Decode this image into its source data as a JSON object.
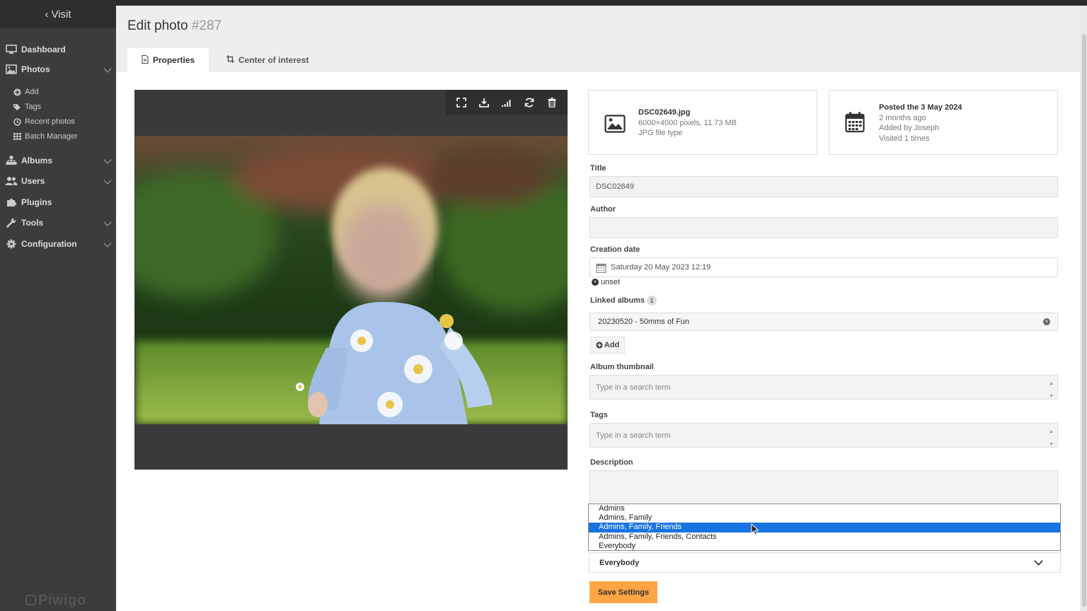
{
  "sidebar": {
    "visit_label": "Visit",
    "menu": [
      {
        "label": "Dashboard",
        "icon": "monitor-icon"
      },
      {
        "label": "Photos",
        "icon": "image-icon",
        "expandable": true
      },
      {
        "label": "Albums",
        "icon": "sitemap-icon",
        "expandable": true
      },
      {
        "label": "Users",
        "icon": "users-icon",
        "expandable": true
      },
      {
        "label": "Plugins",
        "icon": "puzzle-icon"
      },
      {
        "label": "Tools",
        "icon": "wrench-icon",
        "expandable": true
      },
      {
        "label": "Configuration",
        "icon": "gear-icon",
        "expandable": true
      }
    ],
    "photos_submenu": [
      {
        "label": "Add",
        "icon": "plus-circle-icon"
      },
      {
        "label": "Tags",
        "icon": "tags-icon"
      },
      {
        "label": "Recent photos",
        "icon": "clock-icon"
      },
      {
        "label": "Batch Manager",
        "icon": "grid-icon"
      }
    ],
    "brand": "Piwigo"
  },
  "page": {
    "title": "Edit photo",
    "photo_id": "#287"
  },
  "tabs": [
    {
      "label": "Properties",
      "active": true,
      "icon": "file-icon"
    },
    {
      "label": "Center of interest",
      "active": false,
      "icon": "crop-icon"
    }
  ],
  "photo_toolbar": [
    "fullscreen-icon",
    "download-icon",
    "signal-icon",
    "sync-icon",
    "trash-icon"
  ],
  "file_info": {
    "filename": "DSC02649.jpg",
    "dimensions": "6000×4000 pixels, 11.73 MB",
    "filetype": "JPG file type"
  },
  "post_info": {
    "posted": "Posted the 3 May 2024",
    "ago": "2 months ago",
    "added_by": "Added by Joseph",
    "visited": "Visited 1 times"
  },
  "form": {
    "title_label": "Title",
    "title_value": "DSC02649",
    "author_label": "Author",
    "author_value": "",
    "creation_date_label": "Creation date",
    "creation_date_value": "Saturday 20 May 2023 12:19",
    "unset_label": "unset",
    "linked_albums_label": "Linked albums",
    "linked_albums_count": "1",
    "linked_album": "20230520 - 50mms of Fun",
    "add_label": "Add",
    "album_thumbnail_label": "Album thumbnail",
    "album_thumbnail_placeholder": "Type in a search term",
    "tags_label": "Tags",
    "tags_placeholder": "Type in a search term",
    "description_label": "Description",
    "privacy_options": [
      "Admins",
      "Admins, Family",
      "Admins, Family, Friends",
      "Admins, Family, Friends, Contacts",
      "Everybody"
    ],
    "privacy_highlighted": "Admins, Family, Friends",
    "privacy_selected": "Everybody",
    "save_label": "Save Settings"
  },
  "colors": {
    "sidebar_bg": "#3c3c3c",
    "accent": "#ffa544",
    "highlight": "#1874e0"
  }
}
